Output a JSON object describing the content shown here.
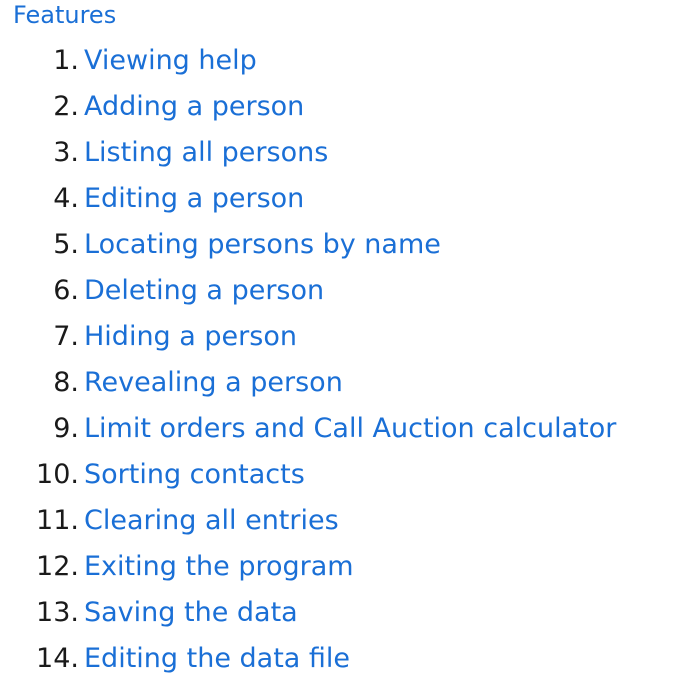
{
  "toc": {
    "heading": "Features",
    "items": [
      {
        "number": "1.",
        "label": "Viewing help"
      },
      {
        "number": "2.",
        "label": "Adding a person"
      },
      {
        "number": "3.",
        "label": "Listing all persons"
      },
      {
        "number": "4.",
        "label": "Editing a person"
      },
      {
        "number": "5.",
        "label": "Locating persons by name"
      },
      {
        "number": "6.",
        "label": "Deleting a person"
      },
      {
        "number": "7.",
        "label": "Hiding a person"
      },
      {
        "number": "8.",
        "label": "Revealing a person"
      },
      {
        "number": "9.",
        "label": "Limit orders and Call Auction calculator"
      },
      {
        "number": "10.",
        "label": "Sorting contacts"
      },
      {
        "number": "11.",
        "label": "Clearing all entries"
      },
      {
        "number": "12.",
        "label": "Exiting the program"
      },
      {
        "number": "13.",
        "label": "Saving the data"
      },
      {
        "number": "14.",
        "label": "Editing the data file"
      }
    ]
  },
  "colors": {
    "link": "#1a6fd6",
    "text": "#1a1a1a",
    "background": "#ffffff"
  }
}
